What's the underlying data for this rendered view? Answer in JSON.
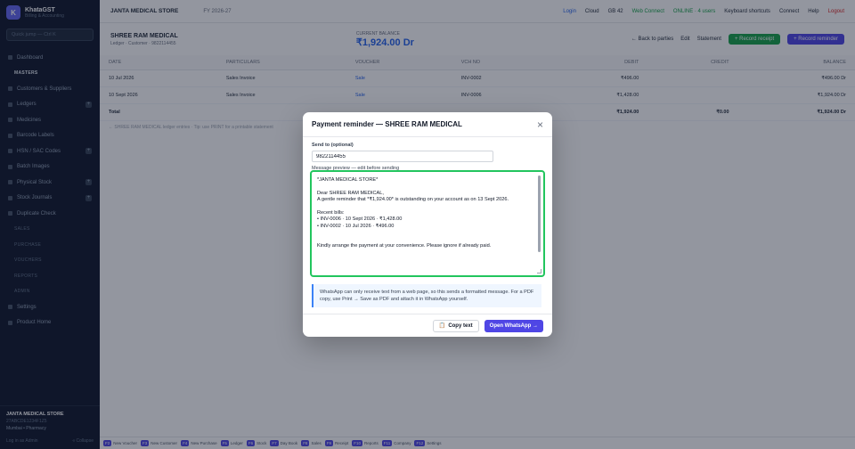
{
  "sidebar": {
    "brand": "KhataGST",
    "brand_sub": "Billing & Accounting",
    "search_placeholder": "Quick jump — Ctrl K",
    "items": [
      {
        "label": "Dashboard",
        "type": "main",
        "plus": false
      },
      {
        "label": "MASTERS",
        "type": "sub",
        "plus": false
      },
      {
        "label": "Customers & Suppliers",
        "type": "main",
        "plus": false
      },
      {
        "label": "Ledgers",
        "type": "main",
        "plus": true
      },
      {
        "label": "Medicines",
        "type": "main",
        "plus": false
      },
      {
        "label": "Barcode Labels",
        "type": "main",
        "plus": false
      },
      {
        "label": "HSN / SAC Codes",
        "type": "main",
        "plus": true
      },
      {
        "label": "Batch Images",
        "type": "main",
        "plus": false
      },
      {
        "label": "Physical Stock",
        "type": "main",
        "plus": true
      },
      {
        "label": "Stock Journals",
        "type": "main",
        "plus": true
      },
      {
        "label": "Duplicate Check",
        "type": "main",
        "plus": false
      },
      {
        "label": "SALES",
        "type": "sub",
        "plus": false
      },
      {
        "label": "PURCHASE",
        "type": "sub",
        "plus": false
      },
      {
        "label": "VOUCHERS",
        "type": "sub",
        "plus": false
      },
      {
        "label": "REPORTS",
        "type": "sub",
        "plus": false
      },
      {
        "label": "ADMIN",
        "type": "sub",
        "plus": false
      },
      {
        "label": "Settings",
        "type": "main",
        "plus": false
      },
      {
        "label": "Product Home",
        "type": "main",
        "plus": false
      }
    ],
    "footer_firm": "JANTA MEDICAL STORE",
    "footer_gstin": "27ABCDE1234F1Z5",
    "footer_loc": "Mumbai • Pharmacy",
    "footer_user": "Log in as Admin",
    "footer_collapse": "« Collapse"
  },
  "topbar": {
    "firm": "JANTA MEDICAL STORE",
    "fy": "FY 2026-27",
    "links": [
      "Login",
      "Cloud",
      "GB 42",
      "Web Connect"
    ],
    "status": "ONLINE · 4 users",
    "pill": "Keyboard shortcuts",
    "user": "Connect",
    "help": "Help",
    "logout": "Logout"
  },
  "ledger": {
    "name": "SHREE RAM MEDICAL",
    "sub": "Ledger · Customer · 9822114455",
    "balance_label": "CURRENT BALANCE",
    "balance_value": "₹1,924.00 Dr",
    "back": "← Back to parties",
    "edit": "Edit",
    "statement": "Statement",
    "receipt": "+ Record receipt",
    "reminder": "+ Record reminder",
    "columns": [
      "DATE",
      "PARTICULARS",
      "VOUCHER",
      "VCH NO",
      "DEBIT",
      "CREDIT",
      "BALANCE"
    ],
    "rows": [
      [
        "10 Jul 2026",
        "Sales Invoice",
        "Sale",
        "INV-0002",
        "₹496.00",
        "",
        "₹496.00 Dr"
      ],
      [
        "10 Sept 2026",
        "Sales Invoice",
        "Sale",
        "INV-0006",
        "₹1,428.00",
        "",
        "₹1,924.00 Dr"
      ]
    ],
    "total": [
      "Total",
      "",
      "",
      "",
      "₹1,924.00",
      "₹0.00",
      "₹1,924.00 Dr"
    ],
    "footnote": "← SHREE RAM MEDICAL ledger entries · Tip: use PRINT for a printable statement"
  },
  "bottombar": [
    {
      "k": "F2",
      "t": "New Voucher"
    },
    {
      "k": "F3",
      "t": "New Customer"
    },
    {
      "k": "F4",
      "t": "New Purchase"
    },
    {
      "k": "F5",
      "t": "Ledger"
    },
    {
      "k": "F6",
      "t": "Stock"
    },
    {
      "k": "F7",
      "t": "Day Book"
    },
    {
      "k": "F8",
      "t": "Sales"
    },
    {
      "k": "F9",
      "t": "Receipt"
    },
    {
      "k": "F10",
      "t": "Reports"
    },
    {
      "k": "F11",
      "t": "Company"
    },
    {
      "k": "F12",
      "t": "Settings"
    }
  ],
  "modal": {
    "title": "Payment reminder — SHREE RAM MEDICAL",
    "send_to_label": "Send to (optional)",
    "phone": "9822114455",
    "preview_label": "Message preview — edit before sending",
    "message_lines": [
      "*JANTA MEDICAL STORE*",
      "",
      "Dear SHREE RAM MEDICAL,",
      "A gentle reminder that *₹1,924.00* is outstanding on your account as on 13 Sept 2026.",
      "",
      "Recent bills:",
      "• INV-0006 · 10 Sept 2026 · ₹1,428.00",
      "• INV-0002 · 10 Jul 2026 · ₹496.00",
      "",
      "",
      "Kindly arrange the payment at your convenience. Please ignore if already paid."
    ],
    "note": "WhatsApp can only receive text from a web page, so this sends a formatted message. For a PDF copy, use Print → Save as PDF and attach it in WhatsApp yourself.",
    "copy_label": "Copy text",
    "whatsapp_label": "Open WhatsApp →"
  }
}
